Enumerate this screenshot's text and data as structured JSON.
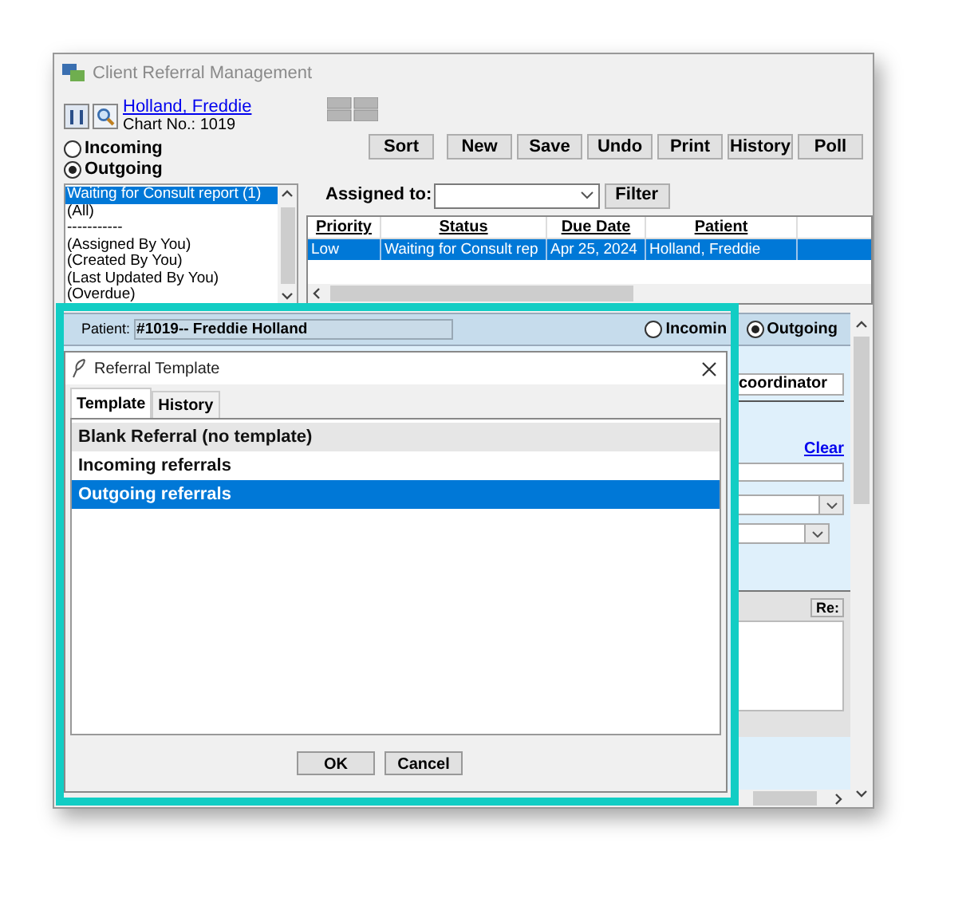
{
  "window": {
    "title": "Client Referral Management"
  },
  "patient": {
    "name": "Holland, Freddie",
    "chart": "Chart No.: 1019"
  },
  "direction": [
    {
      "label": "Incoming",
      "selected": false
    },
    {
      "label": "Outgoing",
      "selected": true
    }
  ],
  "filters": [
    {
      "label": "Waiting for Consult report (1)",
      "selected": true
    },
    {
      "label": "(All)",
      "selected": false
    },
    {
      "label": "-----------",
      "selected": false
    },
    {
      "label": "(Assigned By You)",
      "selected": false
    },
    {
      "label": "(Created By You)",
      "selected": false
    },
    {
      "label": "(Last Updated By You)",
      "selected": false
    },
    {
      "label": "(Overdue)",
      "selected": false
    }
  ],
  "toolbar": [
    "Sort",
    "New",
    "Save",
    "Undo",
    "Print",
    "History",
    "Poll"
  ],
  "assigned": {
    "label": "Assigned to:",
    "button": "Filter"
  },
  "table": {
    "columns": [
      "Priority",
      "Status",
      "Due Date",
      "Patient"
    ],
    "rows": [
      {
        "cells": [
          "Low",
          "Waiting for Consult rep",
          "Apr 25, 2024",
          "Holland, Freddie"
        ],
        "selected": true
      }
    ]
  },
  "detail": {
    "patient_label": "Patient:",
    "patient_value": "#1019-- Freddie Holland",
    "direction": [
      {
        "label": "Incomin",
        "selected": false
      },
      {
        "label": "Outgoing",
        "selected": true
      }
    ],
    "coordinator": "coordinator",
    "clear": "Clear",
    "reply": "Re:"
  },
  "dialog": {
    "title": "Referral Template",
    "tabs": [
      {
        "label": "Template",
        "selected": true
      },
      {
        "label": "History",
        "selected": false
      }
    ],
    "templates": [
      {
        "label": "Blank Referral (no template)",
        "kind": "blank",
        "selected": false
      },
      {
        "label": "Incoming referrals",
        "kind": "template",
        "selected": false
      },
      {
        "label": "Outgoing referrals",
        "kind": "template",
        "selected": true
      }
    ],
    "buttons": [
      "OK",
      "Cancel"
    ]
  }
}
